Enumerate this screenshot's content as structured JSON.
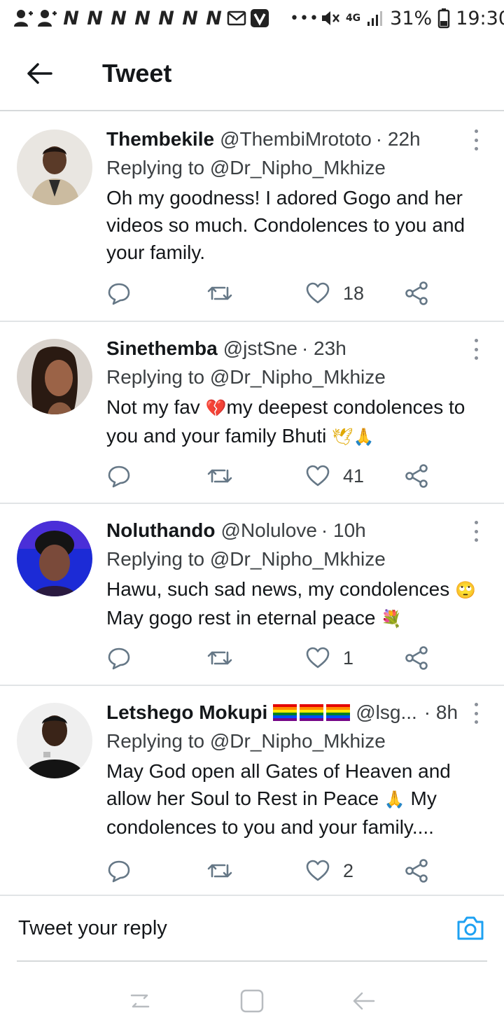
{
  "status_bar": {
    "notif_letters": [
      "N",
      "N",
      "N",
      "N",
      "N",
      "N",
      "N"
    ],
    "network": "4G",
    "battery": "31%",
    "time": "19:30"
  },
  "header": {
    "title": "Tweet"
  },
  "tweets": [
    {
      "name": "Thembekile",
      "handle": "@ThembiMrototo",
      "time": "· 22h",
      "replying_prefix": "Replying to",
      "replying_to": "@Dr_Nipho_Mkhize",
      "text": "Oh my goodness! I adored Gogo and her videos so much. Condolences to you and your family.",
      "likes": "18"
    },
    {
      "name": "Sinethemba",
      "handle": "@jstSne",
      "time": "· 23h",
      "replying_prefix": "Replying to",
      "replying_to": "@Dr_Nipho_Mkhize",
      "text_a": "Not my fav ",
      "emoji_a": "💔",
      "text_b": "my deepest condolences to you and your family Bhuti ",
      "emoji_b": "🕊🙏",
      "likes": "41"
    },
    {
      "name": "Noluthando",
      "handle": "@Nolulove",
      "time": "· 10h",
      "replying_prefix": "Replying to",
      "replying_to": "@Dr_Nipho_Mkhize",
      "text_a": "Hawu, such sad news, my condolences ",
      "emoji_a": "🙄",
      "text_b": " May gogo rest in eternal peace ",
      "emoji_b": "💐",
      "likes": "1"
    },
    {
      "name": "Letshego Mokupi",
      "name_flags": "🏳️‍🌈🏳️‍🌈🏳️‍🌈",
      "handle": "@lsg...",
      "time": "· 8h",
      "replying_prefix": "Replying to",
      "replying_to": "@Dr_Nipho_Mkhize",
      "text_a": "May God open all Gates of Heaven and allow her Soul to Rest in Peace ",
      "emoji_a": "🙏",
      "text_b": " My condolences to you and your family....",
      "likes": "2"
    }
  ],
  "reply_bar": {
    "placeholder": "Tweet your reply"
  },
  "colors": {
    "accent": "#1da1f2",
    "text": "#14171a",
    "secondary": "#3c4043",
    "icon_gray": "#657786",
    "divider": "#e1e4e6"
  }
}
